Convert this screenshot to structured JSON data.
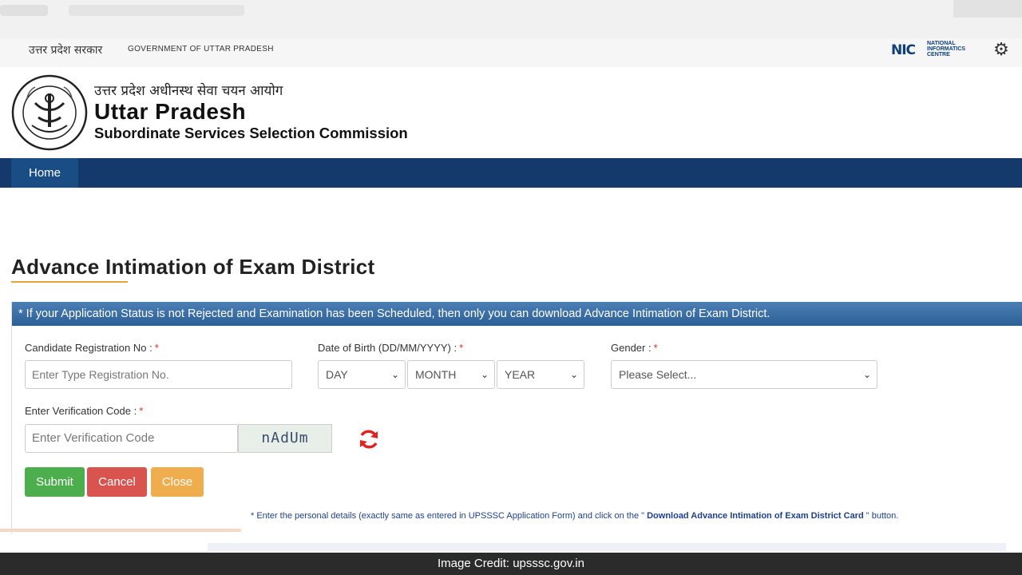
{
  "gov_bar": {
    "hindi": "उत्तर प्रदेश सरकार",
    "english": "GOVERNMENT OF UTTAR PRADESH",
    "nic_mark": "NIC",
    "nic_line1": "NATIONAL",
    "nic_line2": "INFORMATICS",
    "nic_line3": "CENTRE"
  },
  "header": {
    "hindi_title": "उत्तर प्रदेश अधीनस्थ सेवा चयन आयोग",
    "title": "Uttar Pradesh",
    "subtitle": "Subordinate Services Selection Commission"
  },
  "nav": {
    "home": "Home"
  },
  "page": {
    "title": "Advance Intimation of Exam District",
    "panel_notice": "* If your Application Status is not Rejected and Examination has been Scheduled, then only you can download Advance Intimation of Exam District."
  },
  "form": {
    "reg_label": "Candidate Registration No :",
    "reg_placeholder": "Enter Type Registration No.",
    "dob_label": "Date of Birth (DD/MM/YYYY) :",
    "day": "DAY",
    "month": "MONTH",
    "year": "YEAR",
    "gender_label": "Gender :",
    "gender_value": "Please Select...",
    "verify_label": "Enter Verification Code :",
    "verify_placeholder": "Enter Verification Code",
    "captcha": "nAdUm",
    "required_mark": "*"
  },
  "buttons": {
    "submit": "Submit",
    "cancel": "Cancel",
    "close": "Close"
  },
  "note": {
    "prefix": "* Enter the personal details (exactly same as entered in UPSSSC Application Form) and click on the \"",
    "bold": " Download Advance Intimation of Exam District Card ",
    "suffix": "\" button."
  },
  "credit": "Image Credit: upsssc.gov.in",
  "colors": {
    "nav_bg": "#133a6b",
    "submit": "#4cae4c",
    "cancel": "#d9534f",
    "close": "#f0ad4e",
    "refresh_icon": "#e02424"
  }
}
